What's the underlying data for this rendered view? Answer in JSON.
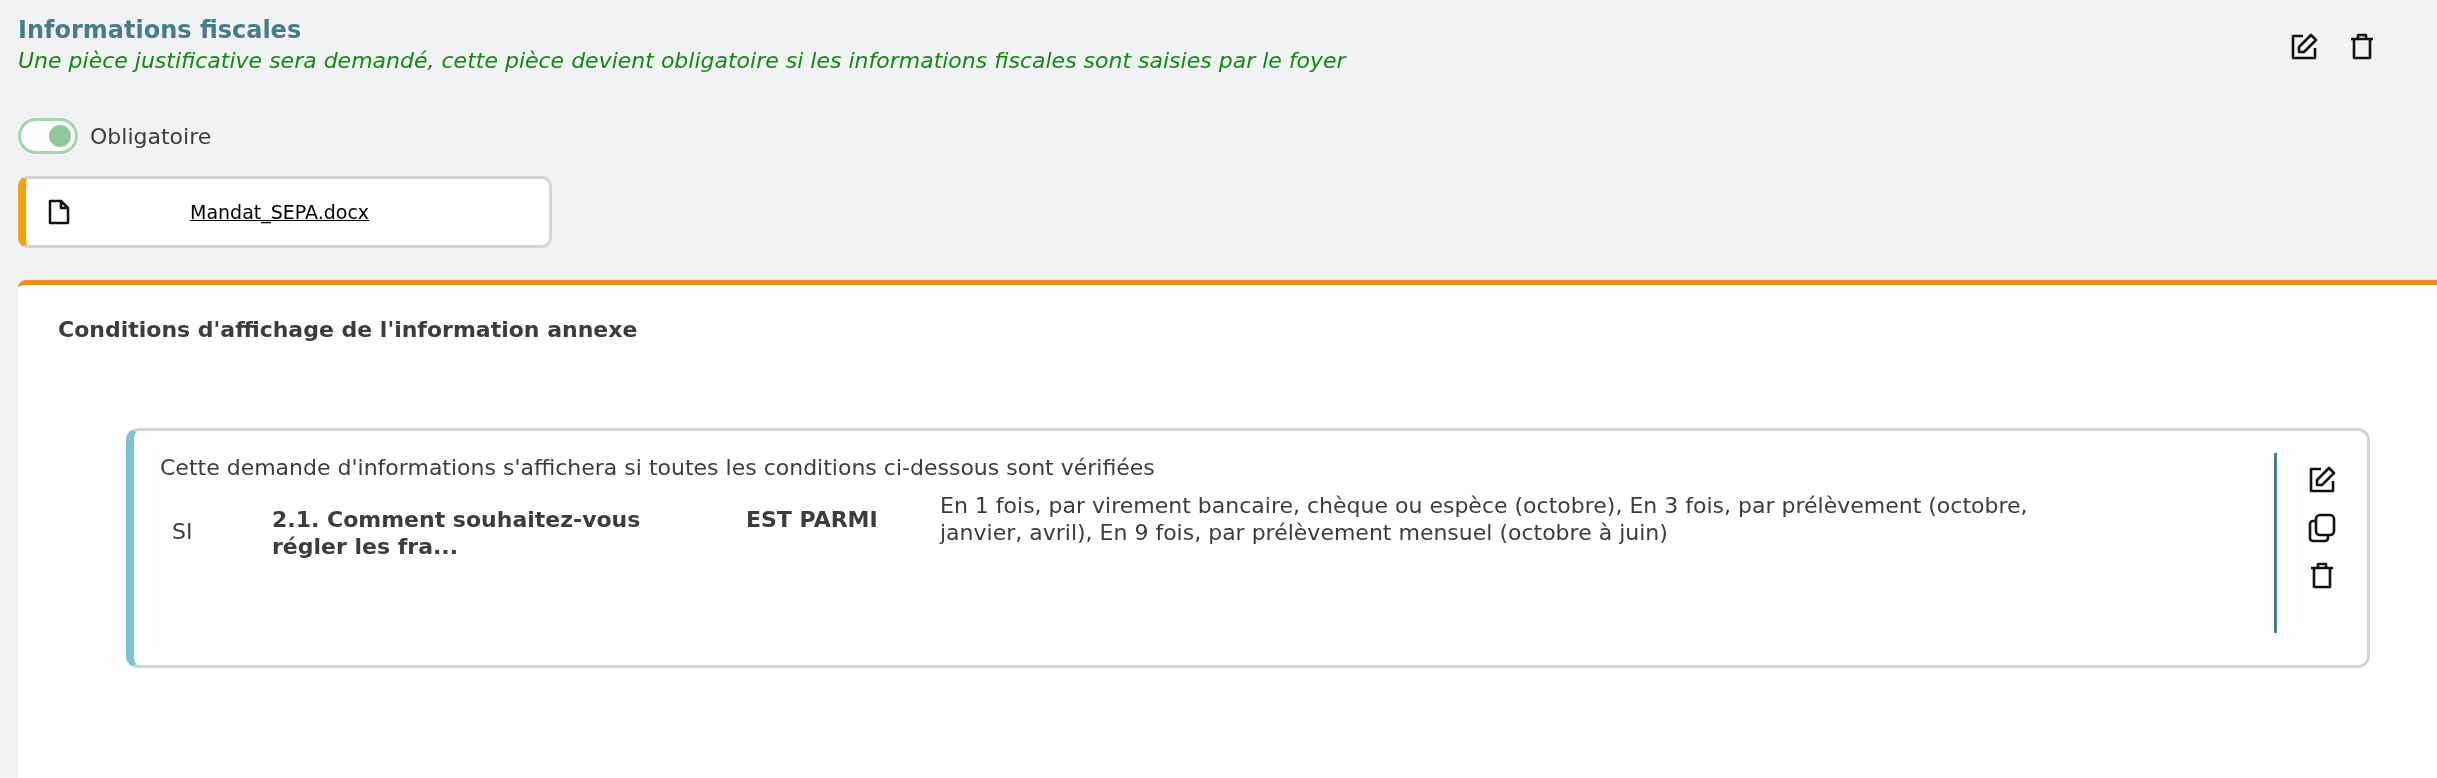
{
  "section": {
    "title": "Informations fiscales",
    "description": "Une pièce justificative sera demandé, cette pièce devient obligatoire si les informations fiscales sont saisies par le foyer"
  },
  "toggle": {
    "label": "Obligatoire",
    "on": true
  },
  "attachment": {
    "filename": "Mandat_SEPA.docx"
  },
  "conditions_panel": {
    "title": "Conditions d'affichage de l'information annexe",
    "intro": "Cette demande d'informations s'affichera si toutes les conditions ci-dessous sont vérifiées",
    "conditions": [
      {
        "keyword": "SI",
        "question": "2.1. Comment souhaitez-vous régler les fra...",
        "operator": "EST PARMI",
        "values": "En 1 fois, par virement bancaire, chèque ou espèce (octobre), En 3 fois, par prélèvement (octobre, janvier, avril), En 9 fois, par prélèvement mensuel (octobre à juin)"
      }
    ]
  }
}
